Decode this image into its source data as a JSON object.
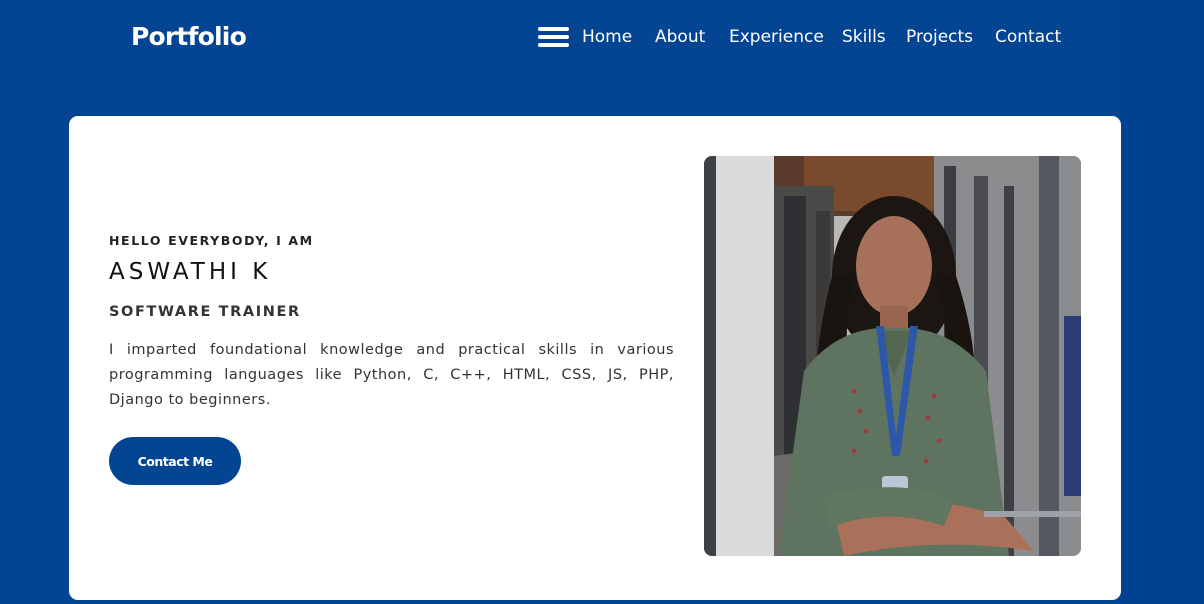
{
  "nav": {
    "logo": "Portfolio",
    "menu_icon": "hamburger-menu-icon",
    "links": [
      "Home",
      "About",
      "Experience",
      "Skills",
      "Projects",
      "Contact"
    ]
  },
  "hero": {
    "greeting": "HELLO EVERYBODY, I AM",
    "name": "ASWATHI K",
    "role": "SOFTWARE TRAINER",
    "description": "I imparted foundational knowledge and practical skills in various programming languages like Python, C, C++, HTML, CSS, JS, PHP, Django to beginners.",
    "cta_label": "Contact Me"
  },
  "colors": {
    "background": "#034592",
    "card": "#ffffff",
    "button": "#034592",
    "text_dark": "#222222"
  }
}
